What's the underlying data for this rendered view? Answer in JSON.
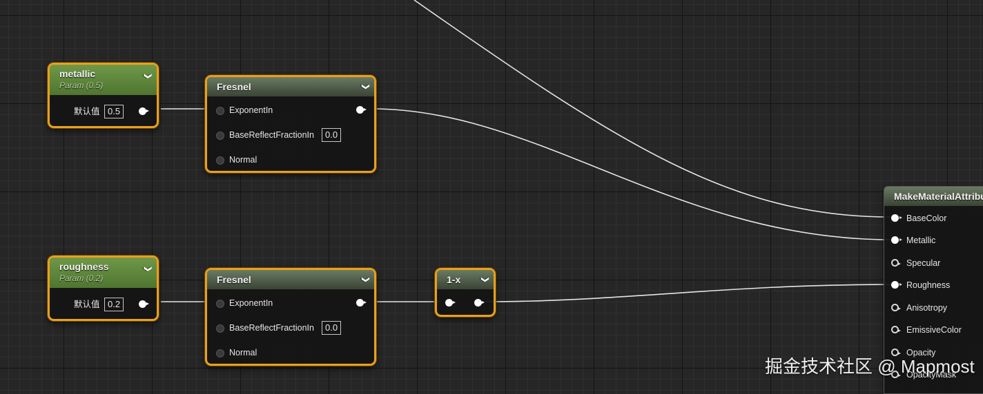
{
  "nodes": {
    "metallic": {
      "title": "metallic",
      "subtitle": "Param (0.5)",
      "default_label": "默认值",
      "default_value": "0.5"
    },
    "roughness": {
      "title": "roughness",
      "subtitle": "Param (0.2)",
      "default_label": "默认值",
      "default_value": "0.2"
    },
    "fresnel_1": {
      "title": "Fresnel",
      "pins": [
        "ExponentIn",
        "BaseReflectFractionIn",
        "Normal"
      ],
      "base_reflect_value": "0.0"
    },
    "fresnel_2": {
      "title": "Fresnel",
      "pins": [
        "ExponentIn",
        "BaseReflectFractionIn",
        "Normal"
      ],
      "base_reflect_value": "0.0"
    },
    "one_minus": {
      "title": "1-x"
    },
    "make_material_attributes": {
      "title": "MakeMaterialAttributes",
      "pins": [
        "BaseColor",
        "Metallic",
        "Specular",
        "Roughness",
        "Anisotropy",
        "EmissiveColor",
        "Opacity",
        "OpacityMask"
      ]
    }
  },
  "watermark": "掘金技术社区 @ Mapmost",
  "colors": {
    "node_border": "#e8a01e",
    "param_header": "#5f8a3c",
    "wire": "#e6e6e6",
    "background": "#262626"
  }
}
